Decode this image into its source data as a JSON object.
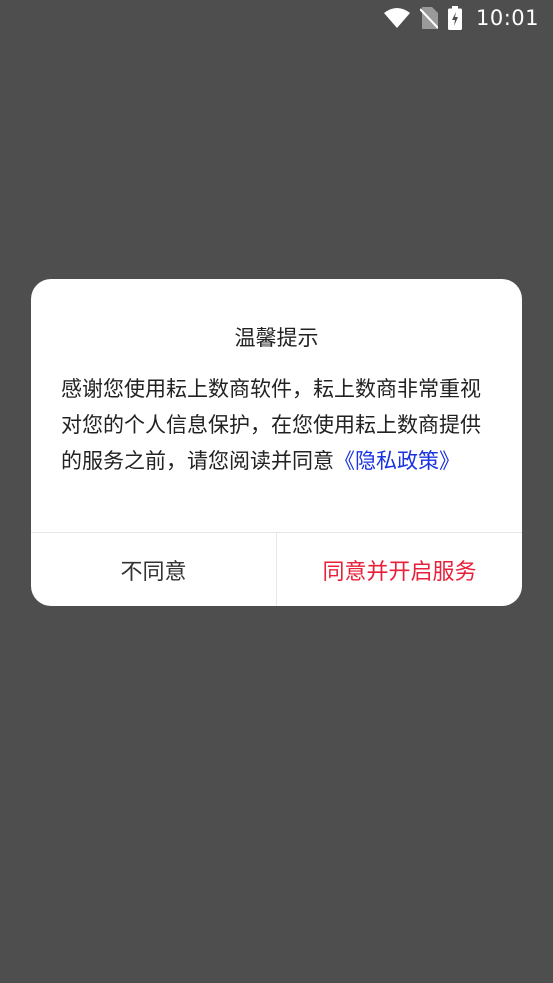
{
  "status_bar": {
    "time": "10:01",
    "icons": [
      "wifi-icon",
      "no-sim-icon",
      "battery-charging-icon"
    ]
  },
  "dialog": {
    "title": "温馨提示",
    "body_text": "感谢您使用耘上数商软件，耘上数商非常重视对您的个人信息保护，在您使用耘上数商提供的服务之前，请您阅读并同意",
    "policy_link": "《隐私政策》",
    "disagree_label": "不同意",
    "agree_label": "同意并开启服务"
  },
  "colors": {
    "background": "#4e4e4e",
    "link": "#1a33e0",
    "agree": "#e8213b"
  }
}
